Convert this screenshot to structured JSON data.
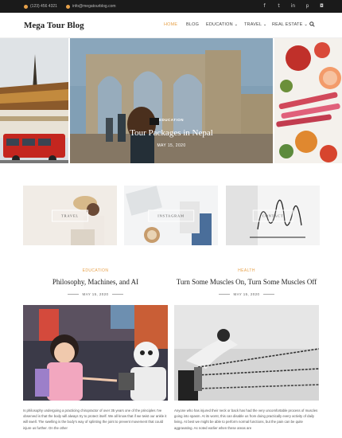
{
  "topbar": {
    "phone": "(123) 456 4321",
    "email": "info@megatourblog.com",
    "social": [
      "facebook-icon",
      "twitter-icon",
      "linkedin-icon",
      "pinterest-icon",
      "instagram-icon"
    ]
  },
  "header": {
    "logo": "Mega Tour Blog",
    "nav": [
      "HOME",
      "BLOG",
      "EDUCATION",
      "TRAVEL",
      "REAL ESTATE"
    ],
    "active": "HOME"
  },
  "slider": {
    "category": "EDUCATION",
    "title": "Tour Packages in Nepal",
    "date": "MAY 15, 2020"
  },
  "promos": [
    "TRAVEL",
    "INSTAGRAM",
    "CONTACT"
  ],
  "posts": [
    {
      "category": "EDUCATION",
      "title": "Philosophy, Machines, and AI",
      "date": "MAY 15, 2020",
      "excerpt": "Is philosophy undergoing a practicing chiropractor of over 35 years one of the principles I've observed is that the body will always try to protect itself. We all know that if we twist our ankle it will swell. The swelling is the body's way of splinting the joint to prevent movement that could injure us further. On the other"
    },
    {
      "category": "HEALTH",
      "title": "Turn Some Muscles On, Turn Some Muscles Off",
      "date": "MAY 15, 2020",
      "excerpt": "Anyone who has injured their neck or back has had the very uncomfortable process of muscles going into spasm. At its worst, this can disable us from doing practically every activity of daily living. At best we might be able to perform normal functions, but the pain can be quite aggravating. As noted earlier when these areas are"
    }
  ],
  "colors": {
    "accent": "#e7a14a",
    "topbar": "#1a1a1a"
  }
}
